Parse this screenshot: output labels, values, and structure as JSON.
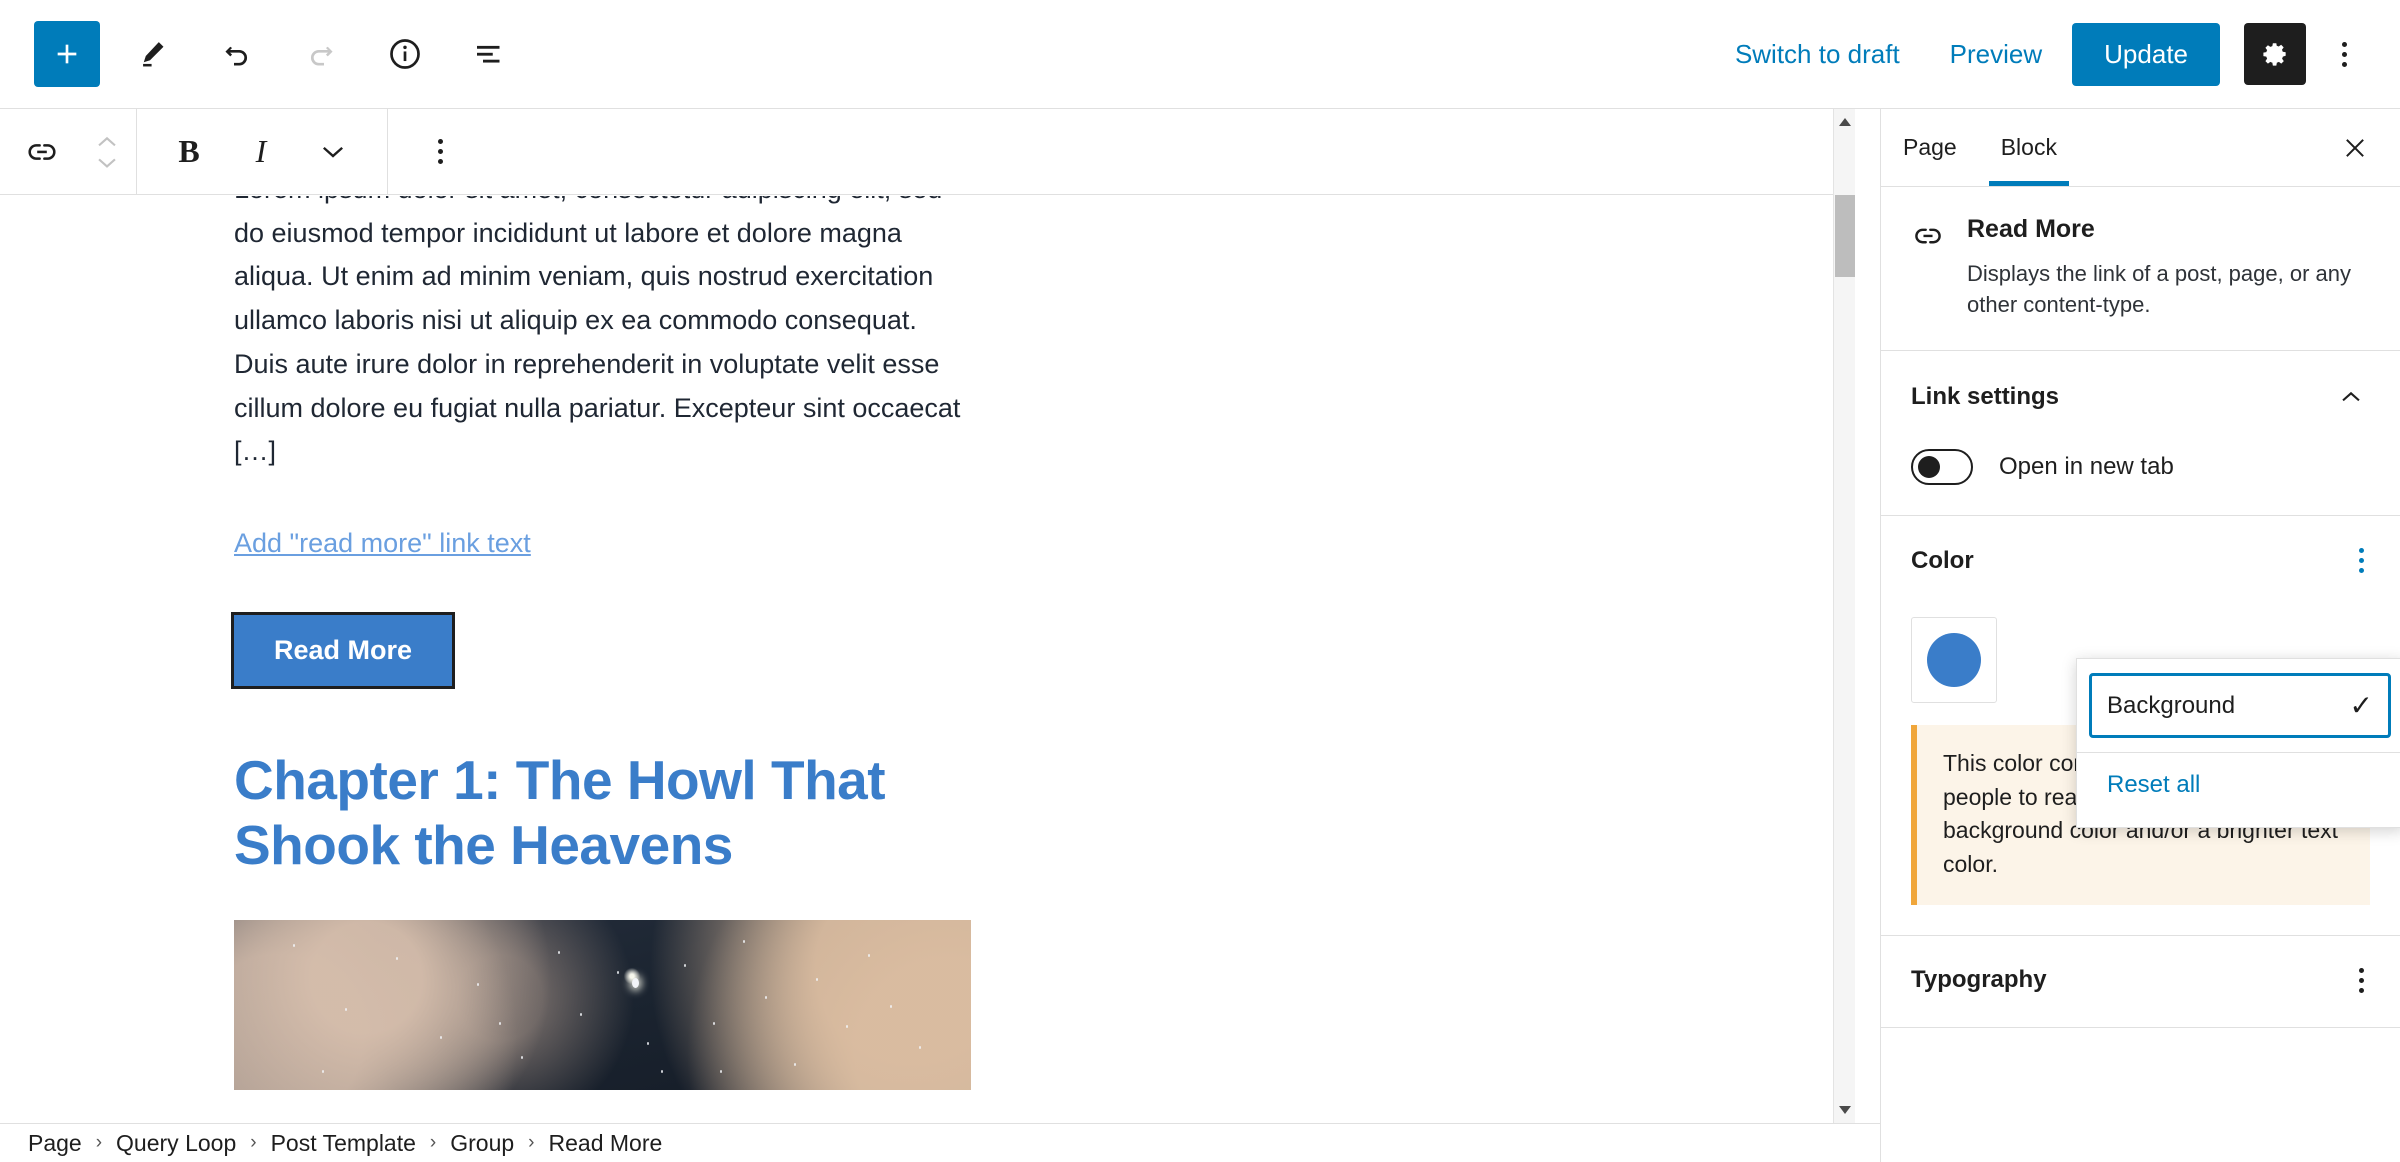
{
  "header": {
    "add_block_icon": "plus-icon",
    "tools_icon": "pencil-icon",
    "undo_icon": "undo-icon",
    "redo_icon": "redo-icon",
    "details_icon": "info-icon",
    "list_view_icon": "list-view-icon",
    "switch_to_draft": "Switch to draft",
    "preview": "Preview",
    "update": "Update",
    "settings_icon": "gear-icon",
    "options_icon": "more-options-icon"
  },
  "block_toolbar": {
    "block_type_icon": "link-icon",
    "move_up_icon": "chevron-up-icon",
    "move_down_icon": "chevron-down-icon",
    "bold": "B",
    "italic": "I",
    "more_formatting_icon": "chevron-down-icon",
    "options_icon": "more-options-icon"
  },
  "canvas": {
    "excerpt": "Lorem ipsum dolor sit amet, consectetur adipiscing elit, sed do eiusmod tempor incididunt ut labore et dolore magna aliqua. Ut enim ad minim veniam, quis nostrud exercitation ullamco laboris nisi ut aliquip ex ea commodo consequat. Duis aute irure dolor in reprehenderit in voluptate velit esse cillum dolore eu fugiat nulla pariatur. Excepteur sint occaecat […]",
    "read_more_placeholder": "Add \"read more\" link text",
    "read_more_button": "Read More",
    "chapter_heading": "Chapter 1: The Howl That Shook the Heavens",
    "image_alt": "night-sky-photo",
    "accent_blue": "#3a7dc9",
    "heading_blue": "#3a7dc9"
  },
  "sidebar": {
    "tabs": [
      {
        "label": "Page",
        "active": false
      },
      {
        "label": "Block",
        "active": true
      }
    ],
    "close_icon": "close-icon",
    "block_card": {
      "icon": "link-icon",
      "title": "Read More",
      "description": "Displays the link of a post, page, or any other content-type."
    },
    "link_settings": {
      "title": "Link settings",
      "collapse_icon": "chevron-up-icon",
      "toggle_label": "Open in new tab",
      "toggle_state": "off"
    },
    "color": {
      "title": "Color",
      "options_icon": "more-options-icon",
      "swatch_color": "#3a7dc9",
      "notice": "This color combination may be hard for people to read. Try using a darker background color and/or a brighter text color."
    },
    "color_popover": {
      "item_label": "Background",
      "item_checked": "✓",
      "reset_all": "Reset all"
    },
    "typography": {
      "title": "Typography",
      "options_icon": "more-options-icon"
    }
  },
  "breadcrumb": {
    "separator": "›",
    "items": [
      "Page",
      "Query Loop",
      "Post Template",
      "Group",
      "Read More"
    ]
  },
  "scrollbar": {
    "up_icon": "scroll-up-arrow-icon",
    "down_icon": "scroll-down-arrow-icon"
  }
}
